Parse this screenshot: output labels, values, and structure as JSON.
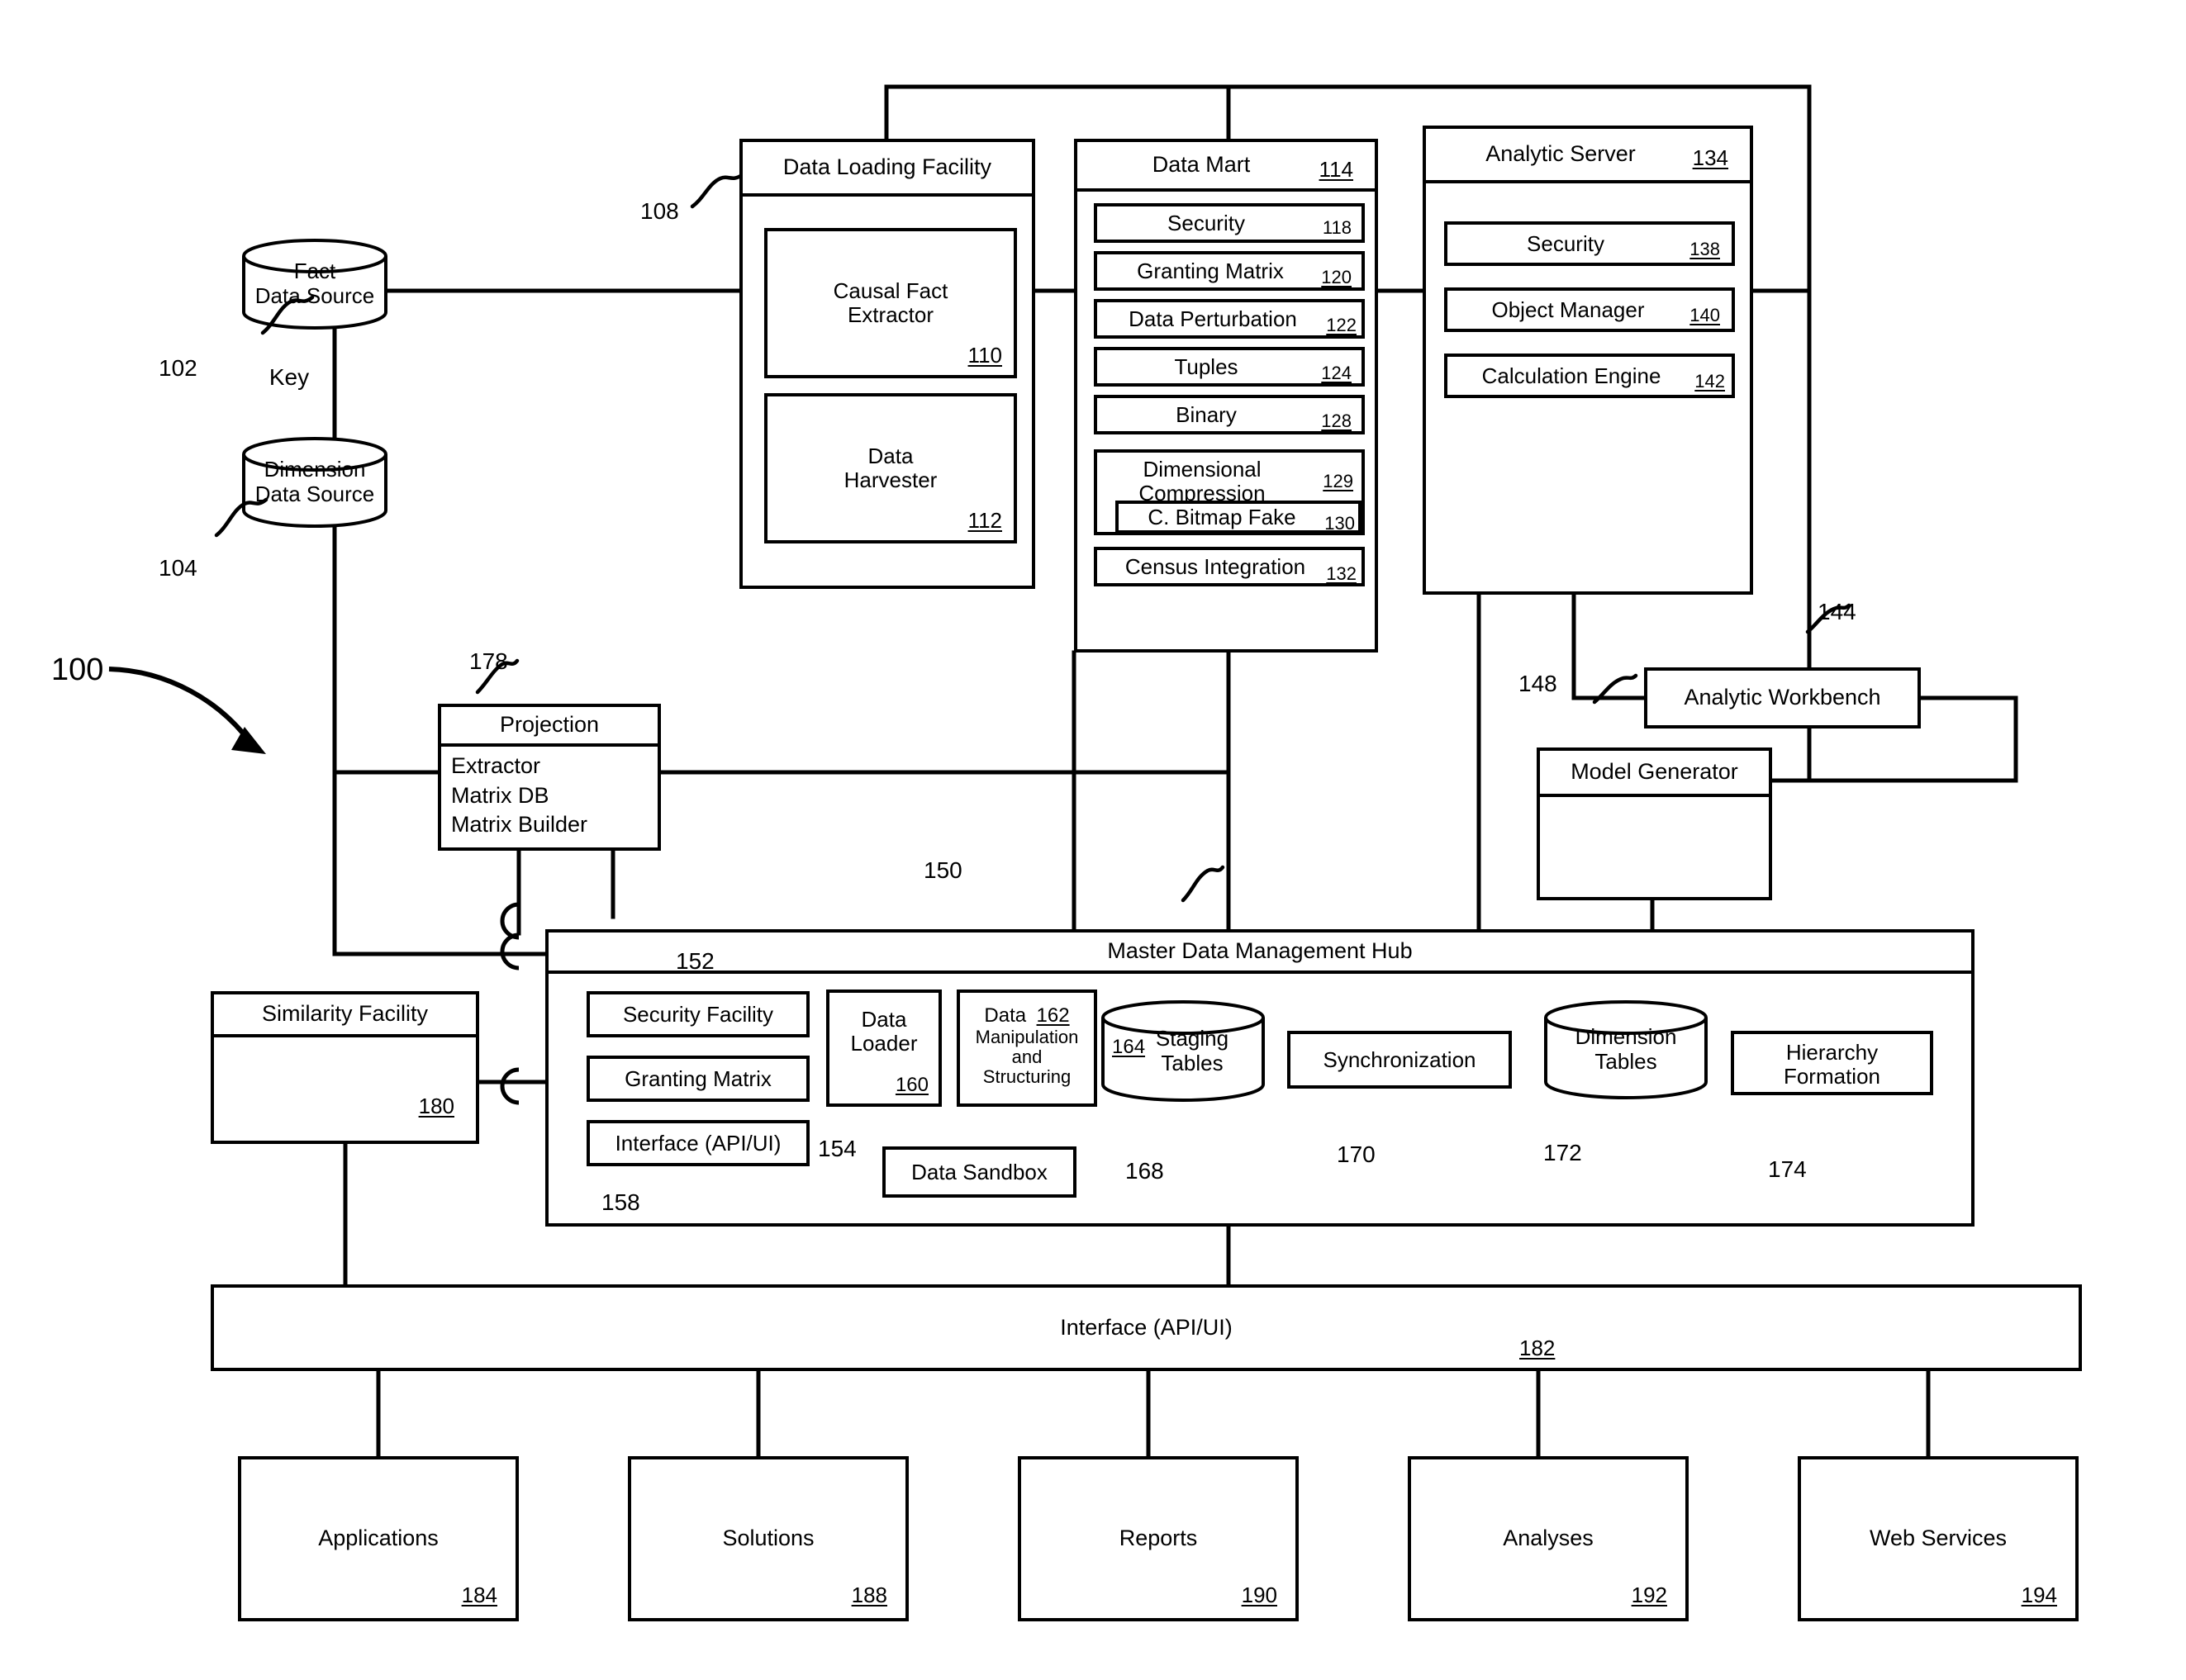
{
  "figure": {
    "system_ref": "100",
    "key_label": "Key"
  },
  "sources": {
    "fact": {
      "line1": "Fact",
      "line2": "Data Source",
      "ref": "102"
    },
    "dimension": {
      "line1": "Dimension",
      "line2": "Data Source",
      "ref": "104"
    }
  },
  "data_loading_facility": {
    "title": "Data Loading Facility",
    "ref": "108",
    "items": [
      {
        "line1": "Causal Fact",
        "line2": "Extractor",
        "ref": "110"
      },
      {
        "line1": "Data",
        "line2": "Harvester",
        "ref": "112"
      }
    ]
  },
  "data_mart": {
    "title": "Data Mart",
    "ref": "114",
    "items": [
      {
        "label": "Security",
        "ref": "118"
      },
      {
        "label": "Granting Matrix",
        "ref": "120"
      },
      {
        "label": "Data Perturbation",
        "ref": "122"
      },
      {
        "label": "Tuples",
        "ref": "124"
      },
      {
        "label": "Binary",
        "ref": "128"
      }
    ],
    "dimensional_compression": {
      "line1": "Dimensional",
      "line2": "Compression",
      "ref": "129",
      "child": {
        "label": "C. Bitmap Fake",
        "ref": "130"
      }
    },
    "census": {
      "label": "Census Integration",
      "ref": "132"
    }
  },
  "analytic_server": {
    "title": "Analytic Server",
    "ref": "134",
    "items": [
      {
        "label": "Security",
        "ref": "138"
      },
      {
        "label": "Object Manager",
        "ref": "140"
      },
      {
        "label": "Calculation Engine",
        "ref": "142"
      }
    ]
  },
  "analytic_workbench": {
    "label": "Analytic Workbench",
    "ref": "144"
  },
  "model_generator": {
    "label": "Model Generator",
    "ref": "148"
  },
  "projection": {
    "title": "Projection",
    "ref": "178",
    "lines": [
      "Extractor",
      "Matrix DB",
      "Matrix Builder"
    ]
  },
  "similarity_facility": {
    "title": "Similarity Facility",
    "ref": "180"
  },
  "mdm_hub": {
    "title": "Master Data Management Hub",
    "ref": "150",
    "inner_ref": "152",
    "left_stack": [
      {
        "label": "Security Facility"
      },
      {
        "label": "Granting Matrix",
        "ref": "154"
      },
      {
        "label": "Interface (API/UI)",
        "ref": "158"
      }
    ],
    "data_loader": {
      "line1": "Data",
      "line2": "Loader",
      "ref": "160"
    },
    "data_manipulation": {
      "line1": "Data",
      "line2": "Manipulation",
      "line3": "and",
      "line4": "Structuring",
      "ref": "162"
    },
    "staging_tables": {
      "line1": "Staging",
      "line2": "Tables",
      "ref": "164"
    },
    "data_sandbox": {
      "label": "Data Sandbox",
      "ref": "168"
    },
    "synchronization": {
      "label": "Synchronization",
      "ref": "170"
    },
    "dimension_tables": {
      "line1": "Dimension",
      "line2": "Tables",
      "ref": "172"
    },
    "hierarchy_formation": {
      "line1": "Hierarchy",
      "line2": "Formation",
      "ref": "174"
    }
  },
  "interface_bar": {
    "label": "Interface (API/UI)",
    "ref": "182"
  },
  "outputs": [
    {
      "label": "Applications",
      "ref": "184"
    },
    {
      "label": "Solutions",
      "ref": "188"
    },
    {
      "label": "Reports",
      "ref": "190"
    },
    {
      "label": "Analyses",
      "ref": "192"
    },
    {
      "label": "Web Services",
      "ref": "194"
    }
  ]
}
